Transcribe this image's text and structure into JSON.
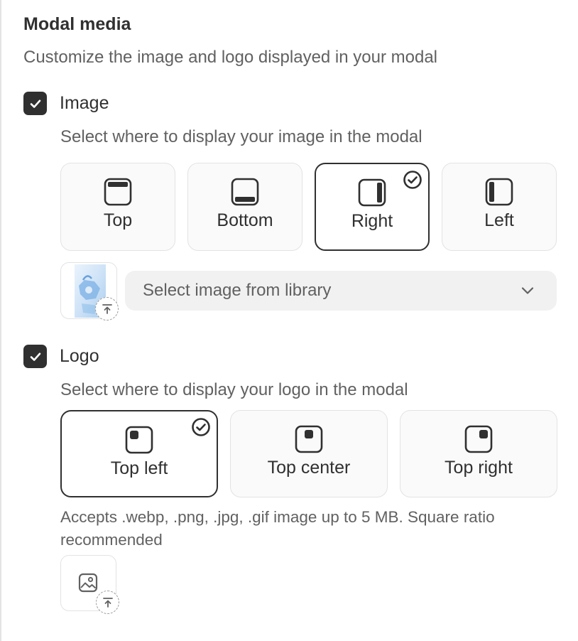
{
  "section": {
    "title": "Modal media",
    "description": "Customize the image and logo displayed in your modal"
  },
  "image": {
    "checkbox_label": "Image",
    "checked": true,
    "instructions": "Select where to display your image in the modal",
    "positions": [
      {
        "label": "Top",
        "icon": "layout-top-icon",
        "selected": false
      },
      {
        "label": "Bottom",
        "icon": "layout-bottom-icon",
        "selected": false
      },
      {
        "label": "Right",
        "icon": "layout-right-icon",
        "selected": true
      },
      {
        "label": "Left",
        "icon": "layout-left-icon",
        "selected": false
      }
    ],
    "library_select": {
      "placeholder": "Select image from library"
    }
  },
  "logo": {
    "checkbox_label": "Logo",
    "checked": true,
    "instructions": "Select where to display your logo in the modal",
    "positions": [
      {
        "label": "Top left",
        "icon": "logo-top-left-icon",
        "selected": true
      },
      {
        "label": "Top center",
        "icon": "logo-top-center-icon",
        "selected": false
      },
      {
        "label": "Top right",
        "icon": "logo-top-right-icon",
        "selected": false
      }
    ],
    "help_text": "Accepts .webp, .png, .jpg, .gif image up to 5 MB. Square ratio recommended"
  },
  "colors": {
    "text_primary": "#303030",
    "text_secondary": "#616161",
    "border": "#e3e3e3",
    "select_bg": "#f1f1f1"
  }
}
